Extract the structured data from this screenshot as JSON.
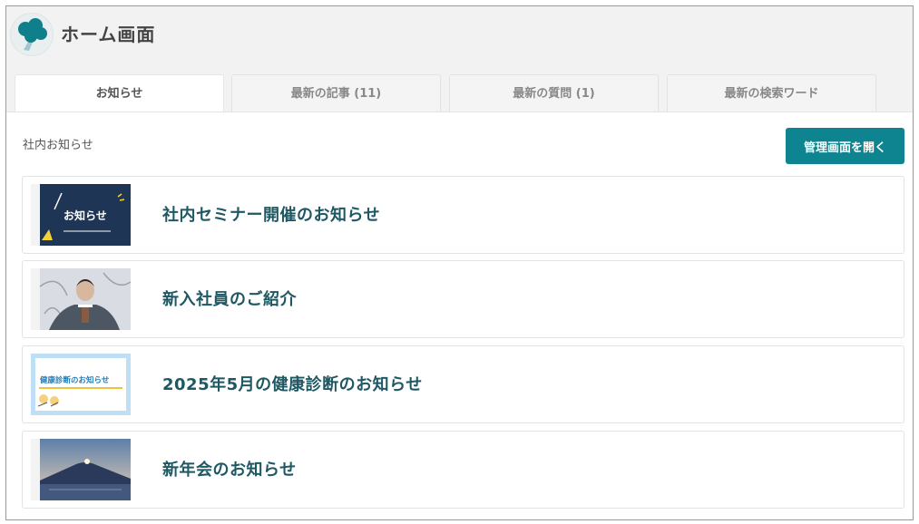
{
  "header": {
    "title": "ホーム画面",
    "logo_icon": "tree-logo-icon"
  },
  "tabs": [
    {
      "label": "お知らせ",
      "active": true
    },
    {
      "label": "最新の記事 (11)",
      "active": false
    },
    {
      "label": "最新の質問 (1)",
      "active": false
    },
    {
      "label": "最新の検索ワード",
      "active": false
    }
  ],
  "section": {
    "label": "社内お知らせ",
    "admin_button": "管理画面を開く"
  },
  "notices": [
    {
      "title": "社内セミナー開催のお知らせ",
      "thumb_text": "お知らせ"
    },
    {
      "title": "新入社員のご紹介"
    },
    {
      "title": "2025年5月の健康診断のお知らせ",
      "thumb_text": "健康診断のお知らせ"
    },
    {
      "title": "新年会のお知らせ"
    }
  ],
  "colors": {
    "accent": "#0e8490",
    "title_text": "#1e5863",
    "header_bg": "#f2f2f2"
  }
}
